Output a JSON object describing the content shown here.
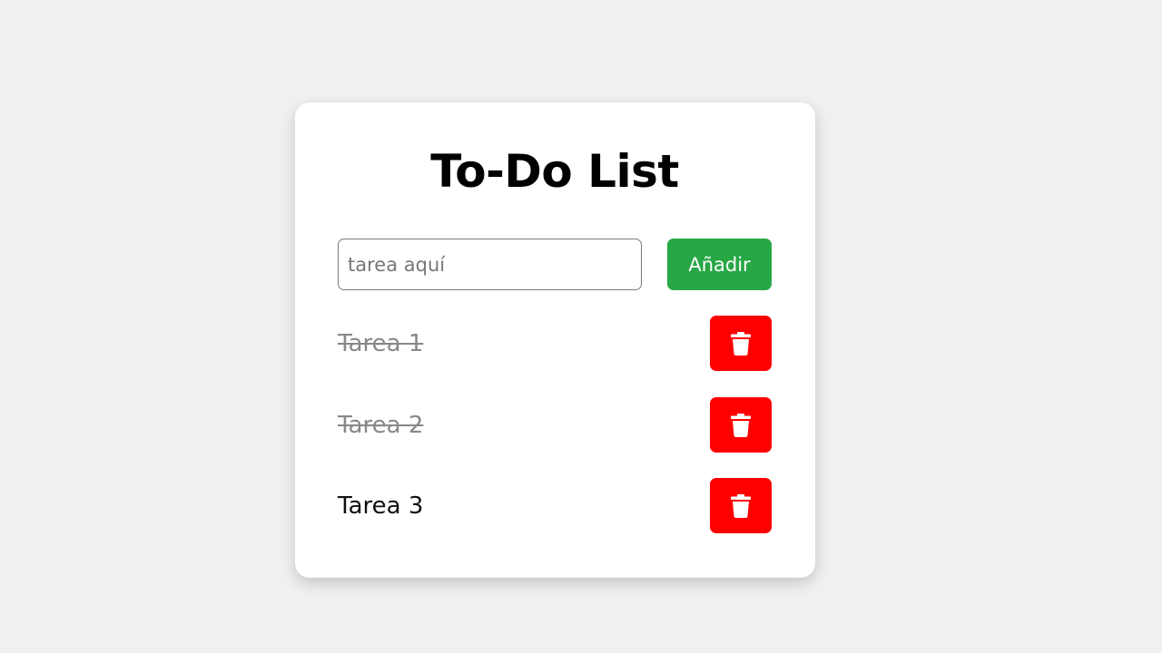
{
  "app": {
    "title": "To-Do List"
  },
  "input": {
    "value": "",
    "placeholder": "tarea aquí"
  },
  "add_button": {
    "label": "Añadir",
    "color": "#28a745"
  },
  "tasks": [
    {
      "label": "Tarea 1",
      "completed": true
    },
    {
      "label": "Tarea 2",
      "completed": true
    },
    {
      "label": "Tarea 3",
      "completed": false
    }
  ],
  "delete_button": {
    "icon": "trash-icon",
    "color": "#ff0000"
  }
}
